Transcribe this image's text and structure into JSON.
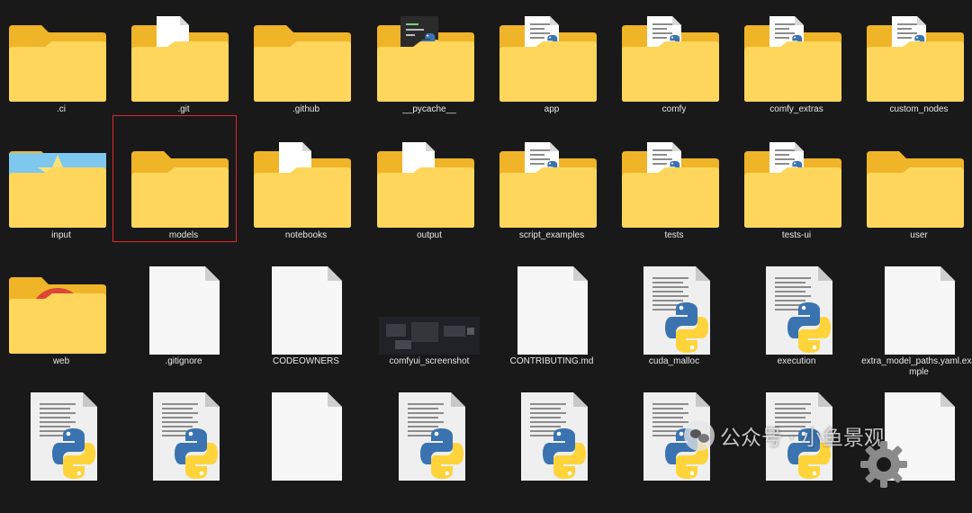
{
  "items": [
    {
      "label": ".ci",
      "icon": "folder-icon"
    },
    {
      "label": ".git",
      "icon": "folder-doc-icon"
    },
    {
      "label": ".github",
      "icon": "folder-icon"
    },
    {
      "label": "__pycache__",
      "icon": "folder-pycache-icon"
    },
    {
      "label": "app",
      "icon": "folder-python-icon"
    },
    {
      "label": "comfy",
      "icon": "folder-python-icon"
    },
    {
      "label": "comfy_extras",
      "icon": "folder-python-icon"
    },
    {
      "label": "custom_nodes",
      "icon": "folder-python-icon"
    },
    {
      "label": "input",
      "icon": "folder-image-icon"
    },
    {
      "label": "models",
      "icon": "folder-icon",
      "selected": true
    },
    {
      "label": "notebooks",
      "icon": "folder-doc-icon"
    },
    {
      "label": "output",
      "icon": "folder-doc-icon"
    },
    {
      "label": "script_examples",
      "icon": "folder-python-icon"
    },
    {
      "label": "tests",
      "icon": "folder-python-icon"
    },
    {
      "label": "tests-ui",
      "icon": "folder-python-icon"
    },
    {
      "label": "user",
      "icon": "folder-icon"
    },
    {
      "label": "web",
      "icon": "folder-chrome-icon"
    },
    {
      "label": ".gitignore",
      "icon": "file-blank-icon"
    },
    {
      "label": "CODEOWNERS",
      "icon": "file-blank-icon"
    },
    {
      "label": "comfyui_screenshot",
      "icon": "image-thumbnail-icon"
    },
    {
      "label": "CONTRIBUTING.md",
      "icon": "file-blank-icon"
    },
    {
      "label": "cuda_malloc",
      "icon": "python-file-icon"
    },
    {
      "label": "execution",
      "icon": "python-file-icon"
    },
    {
      "label": "extra_model_paths.yaml.example",
      "icon": "file-blank-icon"
    },
    {
      "label": "",
      "icon": "python-file-icon"
    },
    {
      "label": "",
      "icon": "python-file-icon"
    },
    {
      "label": "",
      "icon": "file-blank-icon"
    },
    {
      "label": "",
      "icon": "python-file-icon"
    },
    {
      "label": "",
      "icon": "python-file-icon"
    },
    {
      "label": "",
      "icon": "python-file-icon"
    },
    {
      "label": "",
      "icon": "python-file-icon"
    },
    {
      "label": "",
      "icon": "file-blank-icon"
    }
  ],
  "watermark": {
    "text": "公众号 · 小鱼景观"
  },
  "colors": {
    "background": "#191919",
    "folder_back": "#f0b429",
    "folder_front": "#ffd65c",
    "python_blue": "#3a73b0",
    "python_yellow": "#ffd43b",
    "selection": "#e0262b"
  }
}
